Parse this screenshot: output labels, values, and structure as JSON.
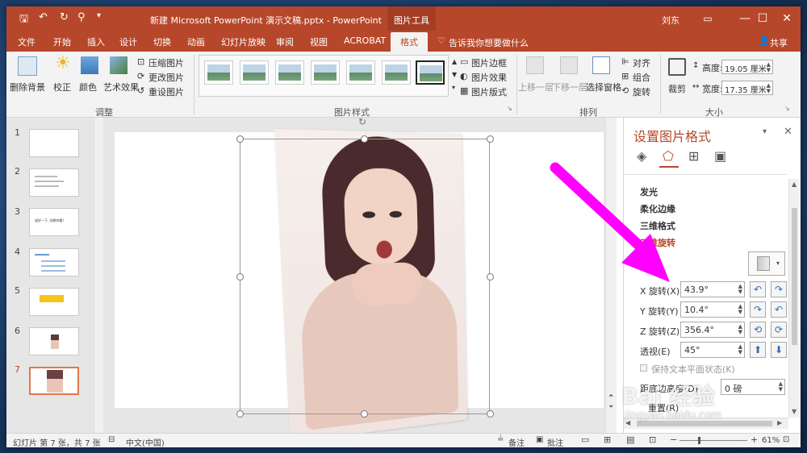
{
  "titlebar": {
    "doc_title": "新建 Microsoft PowerPoint 演示文稿.pptx  -  PowerPoint",
    "context_tab": "图片工具",
    "user": "刘东"
  },
  "tabs": [
    "文件",
    "开始",
    "插入",
    "设计",
    "切换",
    "动画",
    "幻灯片放映",
    "审阅",
    "视图",
    "ACROBAT",
    "格式"
  ],
  "tell_me": "告诉我你想要做什么",
  "share": "共享",
  "ribbon": {
    "adjust": {
      "remove_bg": "删除背景",
      "correct": "校正",
      "color": "颜色",
      "art_effect": "艺术效果",
      "compress": "压缩图片",
      "change": "更改图片",
      "reset": "重设图片",
      "group_label": "调整"
    },
    "styles": {
      "border": "图片边框",
      "effects": "图片效果",
      "layout": "图片版式",
      "group_label": "图片样式"
    },
    "arrange": {
      "bring_forward": "上移一层",
      "send_backward": "下移一层",
      "selection_pane": "选择窗格",
      "align": "对齐",
      "group": "组合",
      "rotate": "旋转",
      "group_label": "排列"
    },
    "size": {
      "crop": "裁剪",
      "height_label": "高度:",
      "height_value": "19.05 厘米",
      "width_label": "宽度:",
      "width_value": "17.35 厘米",
      "group_label": "大小"
    }
  },
  "slides": [
    {
      "num": "1"
    },
    {
      "num": "2"
    },
    {
      "num": "3",
      "text": "说好一下, 别想你看！"
    },
    {
      "num": "4"
    },
    {
      "num": "5"
    },
    {
      "num": "6"
    },
    {
      "num": "7"
    }
  ],
  "format_pane": {
    "title": "设置图片格式",
    "sections": [
      "发光",
      "柔化边缘",
      "三维格式",
      "三维旋转"
    ],
    "preset_label": "预",
    "x_label": "X 旋转(X)",
    "x_value": "43.9°",
    "y_label": "Y 旋转(Y)",
    "y_value": "10.4°",
    "z_label": "Z 旋转(Z)",
    "z_value": "356.4°",
    "persp_label": "透视(E)",
    "persp_value": "45°",
    "keep_flat": "保持文本平面状态(K)",
    "dist_label": "距底边高度(D)",
    "dist_value": "0 磅",
    "reset_label": "重置(R)"
  },
  "status": {
    "slide_info": "幻灯片 第 7 张，共 7 张",
    "language": "中文(中国)",
    "notes": "备注",
    "comments": "批注",
    "zoom": "61%"
  },
  "watermark": {
    "brand": "Bai 经验",
    "url": "jingyan.baidu.com"
  },
  "colors": {
    "accent": "#b7472a",
    "arrow": "#ff00ff"
  }
}
